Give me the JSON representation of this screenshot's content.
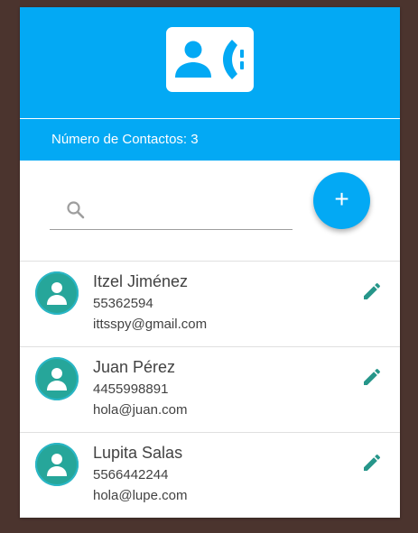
{
  "colors": {
    "primary": "#03a9f4",
    "avatar": "#26a69a",
    "edit_icon": "#26968a",
    "background": "#4b342e"
  },
  "header": {
    "icon": "contact-phone-icon",
    "count_text": "Número de Contactos: 3"
  },
  "search": {
    "icon": "search-icon",
    "placeholder": "",
    "value": ""
  },
  "add_button": {
    "label": "+",
    "icon": "add-icon"
  },
  "contacts": [
    {
      "name": "Itzel Jiménez",
      "phone": "55362594",
      "email": "ittsspy@gmail.com",
      "avatar_icon": "person-icon",
      "edit_icon": "pencil-icon"
    },
    {
      "name": "Juan Pérez",
      "phone": "4455998891",
      "email": "hola@juan.com",
      "avatar_icon": "person-icon",
      "edit_icon": "pencil-icon"
    },
    {
      "name": "Lupita Salas",
      "phone": "5566442244",
      "email": "hola@lupe.com",
      "avatar_icon": "person-icon",
      "edit_icon": "pencil-icon"
    }
  ]
}
